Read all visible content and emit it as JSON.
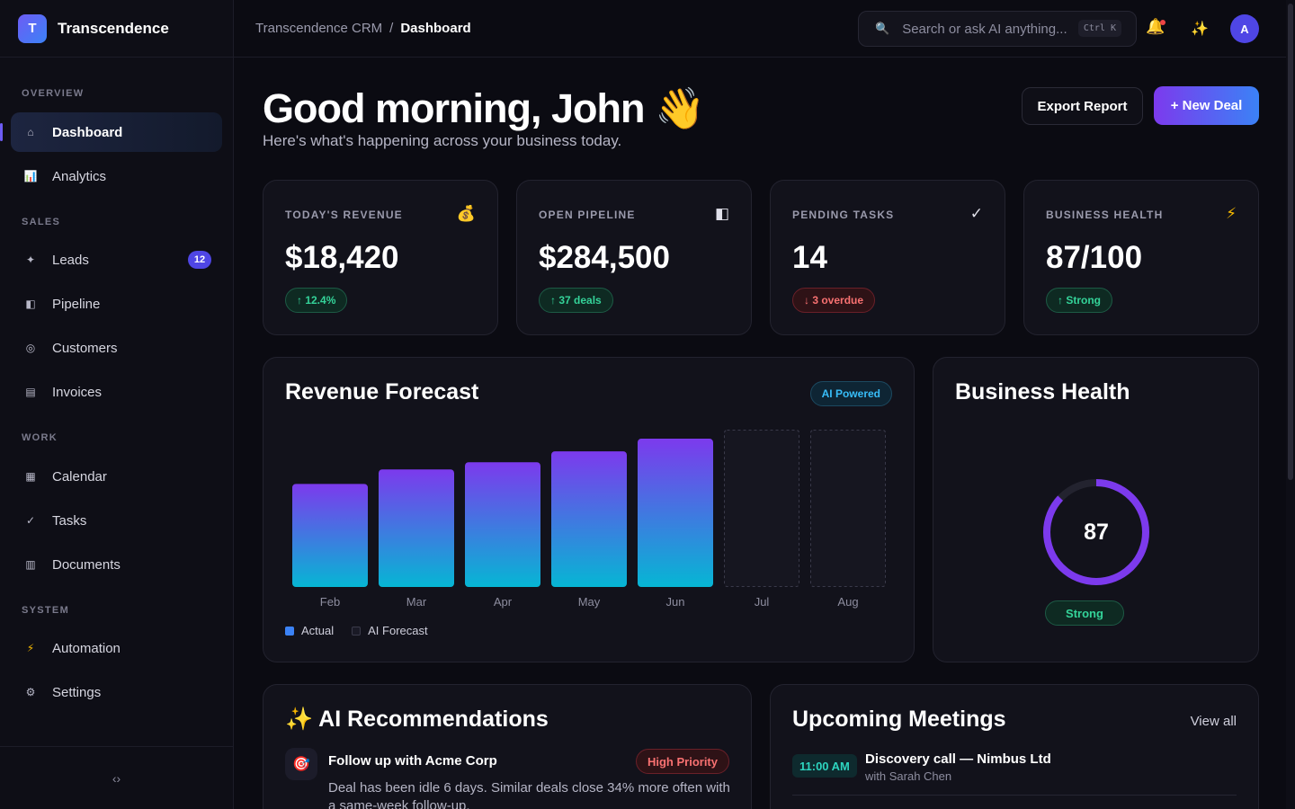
{
  "brand": {
    "logo_letter": "T",
    "name": "Transcendence"
  },
  "sidebar": {
    "sections": [
      {
        "label": "OVERVIEW"
      },
      {
        "label": "SALES"
      },
      {
        "label": "WORK"
      },
      {
        "label": "SYSTEM"
      }
    ],
    "items": [
      {
        "label": "Dashboard",
        "icon": "⌂",
        "icon_name": "home-icon"
      },
      {
        "label": "Analytics",
        "icon": "📊",
        "icon_name": "bar-chart-icon"
      },
      {
        "label": "Leads",
        "icon": "✦",
        "icon_name": "sparkle-icon",
        "badge": "12"
      },
      {
        "label": "Pipeline",
        "icon": "◧",
        "icon_name": "pipeline-icon"
      },
      {
        "label": "Customers",
        "icon": "◎",
        "icon_name": "customers-icon"
      },
      {
        "label": "Invoices",
        "icon": "▤",
        "icon_name": "invoice-icon"
      },
      {
        "label": "Calendar",
        "icon": "▦",
        "icon_name": "calendar-icon"
      },
      {
        "label": "Tasks",
        "icon": "✓",
        "icon_name": "check-icon"
      },
      {
        "label": "Documents",
        "icon": "▥",
        "icon_name": "document-icon"
      },
      {
        "label": "Automation",
        "icon": "⚡",
        "icon_name": "lightning-icon"
      },
      {
        "label": "Settings",
        "icon": "⚙",
        "icon_name": "gear-icon"
      }
    ],
    "collapse_icon": "‹›"
  },
  "topbar": {
    "breadcrumb": {
      "root": "Transcendence CRM",
      "sep": "/",
      "current": "Dashboard"
    },
    "search": {
      "icon": "🔍",
      "placeholder": "Search or ask AI anything...",
      "shortcut": "Ctrl K"
    },
    "notification_icon": "🔔",
    "ai_icon": "✨",
    "avatar_initial": "A"
  },
  "header": {
    "greeting": "Good morning, John 👋",
    "subtitle": "Here's what's happening across your business today.",
    "export_label": "Export Report",
    "new_deal_label": "+ New Deal"
  },
  "stats": [
    {
      "label": "TODAY'S REVENUE",
      "icon": "💰",
      "value": "$18,420",
      "delta": "↑ 12.4%",
      "trend": "up"
    },
    {
      "label": "OPEN PIPELINE",
      "icon": "◧",
      "value": "$284,500",
      "delta": "↑ 37 deals",
      "trend": "up"
    },
    {
      "label": "PENDING TASKS",
      "icon": "✓",
      "value": "14",
      "delta": "↓ 3 overdue",
      "trend": "down"
    },
    {
      "label": "BUSINESS HEALTH",
      "icon": "⚡",
      "value": "87/100",
      "delta": "↑ Strong",
      "trend": "up"
    }
  ],
  "forecast": {
    "title": "Revenue Forecast",
    "badge": "AI Powered",
    "legend_actual": "Actual",
    "legend_forecast": "AI Forecast"
  },
  "chart_data": {
    "type": "bar",
    "title": "Revenue Forecast",
    "categories": [
      "Feb",
      "Mar",
      "Apr",
      "May",
      "Jun",
      "Jul",
      "Aug"
    ],
    "series": [
      {
        "name": "Actual",
        "values": [
          114,
          130,
          138,
          150,
          164,
          null,
          null
        ]
      },
      {
        "name": "AI Forecast",
        "values": [
          null,
          null,
          null,
          null,
          null,
          174,
          174
        ]
      }
    ],
    "ylim": [
      0,
      174
    ],
    "grid": false,
    "legend": "bottom-left"
  },
  "health": {
    "title": "Business Health",
    "score": 87,
    "max": 100,
    "label": "Strong",
    "ring_color": "#7c3aed"
  },
  "recommendations": {
    "icon": "✨",
    "title": "AI Recommendations",
    "items": [
      {
        "icon": "🎯",
        "title": "Follow up with Acme Corp",
        "priority": "High Priority",
        "description": "Deal has been idle 6 days. Similar deals close 34% more often with a same-week follow-up."
      }
    ]
  },
  "meetings": {
    "title": "Upcoming Meetings",
    "view_all": "View all",
    "items": [
      {
        "time": "11:00 AM",
        "title": "Discovery call — Nimbus Ltd",
        "with": "with Sarah Chen"
      }
    ]
  },
  "colors": {
    "accent": "#6d5cf5",
    "accent_blue": "#3b82f6",
    "success": "#34d399",
    "danger": "#f87171"
  }
}
